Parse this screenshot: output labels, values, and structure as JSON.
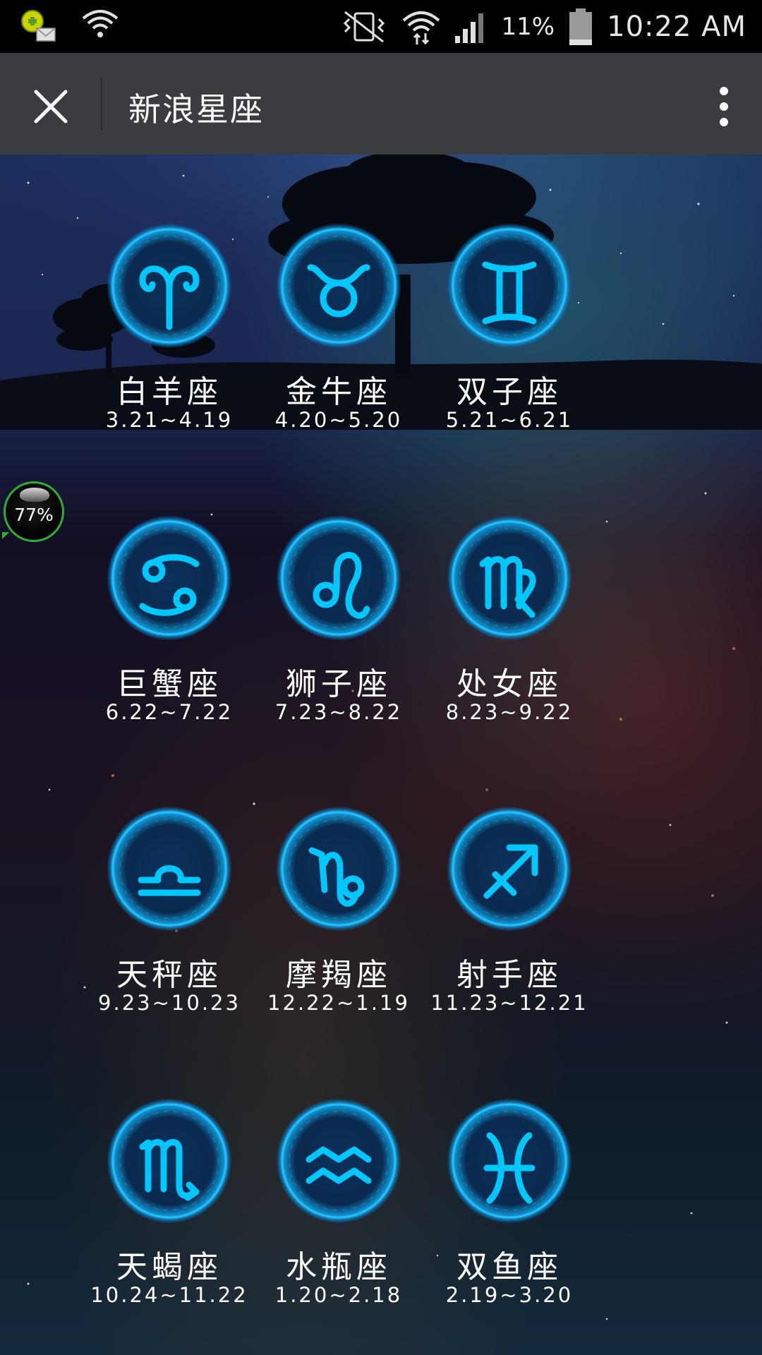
{
  "status_bar": {
    "battery_percent": "11%",
    "time": "10:22 AM"
  },
  "action_bar": {
    "title": "新浪星座"
  },
  "floating_widget": {
    "text": "77%"
  },
  "accent_color": "#00c8ff",
  "signs": [
    {
      "name": "白羊座",
      "dates": "3.21~4.19",
      "icon": "aries-icon"
    },
    {
      "name": "金牛座",
      "dates": "4.20~5.20",
      "icon": "taurus-icon"
    },
    {
      "name": "双子座",
      "dates": "5.21~6.21",
      "icon": "gemini-icon"
    },
    {
      "name": "巨蟹座",
      "dates": "6.22~7.22",
      "icon": "cancer-icon"
    },
    {
      "name": "狮子座",
      "dates": "7.23~8.22",
      "icon": "leo-icon"
    },
    {
      "name": "处女座",
      "dates": "8.23~9.22",
      "icon": "virgo-icon"
    },
    {
      "name": "天秤座",
      "dates": "9.23~10.23",
      "icon": "libra-icon"
    },
    {
      "name": "摩羯座",
      "dates": "12.22~1.19",
      "icon": "capricorn-icon"
    },
    {
      "name": "射手座",
      "dates": "11.23~12.21",
      "icon": "sagittarius-icon"
    },
    {
      "name": "天蝎座",
      "dates": "10.24~11.22",
      "icon": "scorpio-icon"
    },
    {
      "name": "水瓶座",
      "dates": "1.20~2.18",
      "icon": "aquarius-icon"
    },
    {
      "name": "双鱼座",
      "dates": "2.19~3.20",
      "icon": "pisces-icon"
    }
  ]
}
